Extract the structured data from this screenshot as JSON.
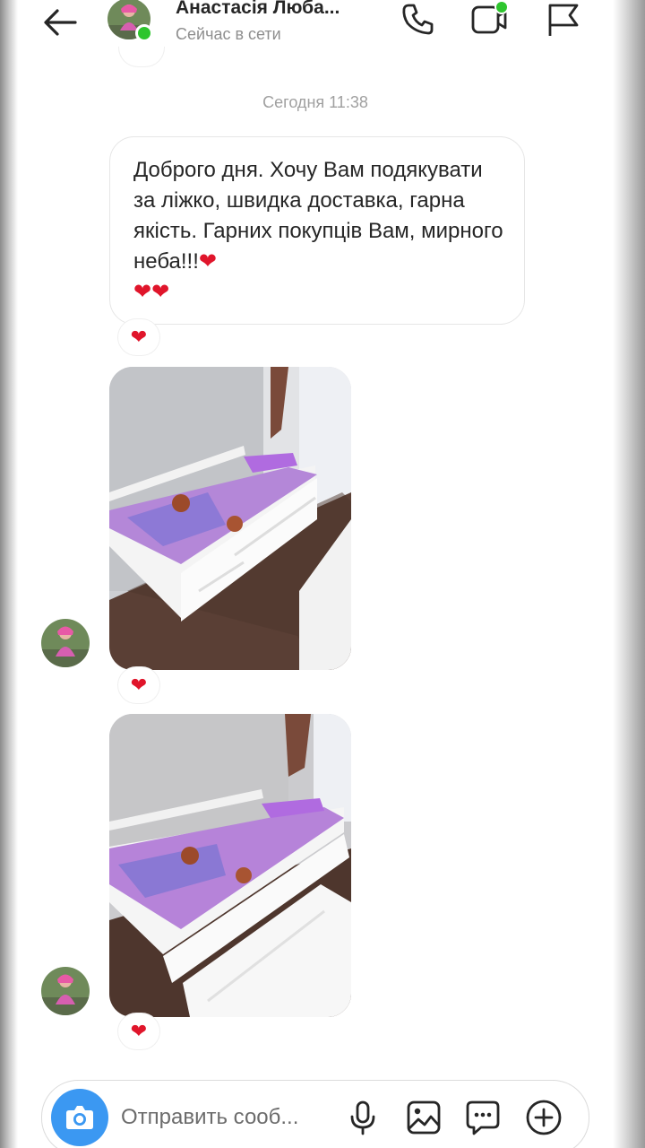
{
  "header": {
    "back_icon": "arrow-left-icon",
    "contact_name": "Анастасія Люба...",
    "status": "Сейчас в сети",
    "icons": [
      "phone-icon",
      "video-icon",
      "flag-icon"
    ],
    "online_color": "#2ec52e"
  },
  "chat": {
    "timestamp": "Сегодня 11:38",
    "message_text": "Доброго дня. Хочу Вам подякувати за ліжко, швидка доставка, гарна якість. Гарних покупців Вам, мирного неба!!!",
    "message_end_hearts": "❤",
    "message_second_line_hearts": "❤❤",
    "reactions": [
      "❤",
      "❤",
      "❤"
    ],
    "photos": [
      {
        "description": "photo-bed-1"
      },
      {
        "description": "photo-bed-2"
      }
    ]
  },
  "composer": {
    "placeholder": "Отправить сооб...",
    "icons": [
      "camera-icon",
      "microphone-icon",
      "gallery-icon",
      "sticker-icon",
      "plus-icon"
    ],
    "camera_color": "#3b98f2"
  }
}
